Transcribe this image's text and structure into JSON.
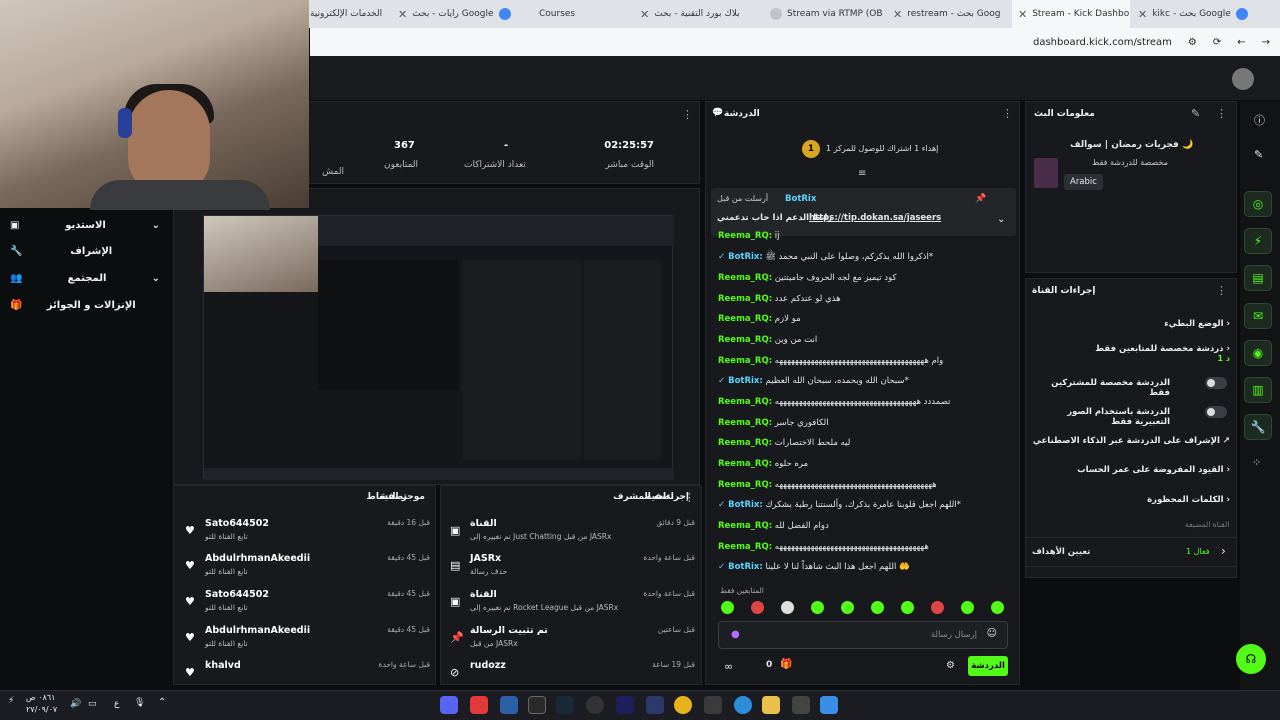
{
  "browser": {
    "tabs": [
      {
        "label": "الخدمات الإلكترونية",
        "color": "#9aa0a6"
      },
      {
        "label": "رايات - بحث Google",
        "color": "#4285f4"
      },
      {
        "label": "Courses",
        "color": "#4285f4"
      },
      {
        "label": "بلاك بورد التقنية - بحث",
        "color": "#ea8600"
      },
      {
        "label": "Stream via RTMP (OB",
        "color": "#1a73e8"
      },
      {
        "label": "restream - بحث Goog",
        "color": "#4285f4"
      },
      {
        "label": "Stream - Kick Dashbo",
        "color": "#53fc18"
      },
      {
        "label": "kikc - بحث Google",
        "color": "#4285f4"
      }
    ],
    "url": "dashboard.kick.com/stream"
  },
  "stats": [
    {
      "value": "02:25:57",
      "label": "الوقت مباشر"
    },
    {
      "value": "-",
      "label": "تعداد الاشتراكات"
    },
    {
      "value": "367",
      "label": "المتابعون"
    }
  ],
  "stats_partial_label": "المش",
  "side_menu": [
    {
      "label": "الاستديو",
      "icon": "studio-icon"
    },
    {
      "label": "الإشراف",
      "icon": "wrench-icon"
    },
    {
      "label": "المجتمع",
      "icon": "community-icon"
    },
    {
      "label": "الإنزالات و الجوائز",
      "icon": "gift-icon"
    }
  ],
  "chat": {
    "title": "الدردشة",
    "goal_text": "إهداء 1 اشتراك للوصول للمركز 1",
    "goal_rank": "1",
    "pinned_by": "أرسلت من قبل",
    "pinned_user": "BotRix",
    "pinned_text": "رابط الدعم اذا حاب تدعمني",
    "pinned_link": "https://tip.dokan.sa/jaseers",
    "messages": [
      {
        "user": "Reema_RQ:",
        "text": "ij",
        "bot": false
      },
      {
        "user": "BotRix:",
        "text": "اذكروا الله يذكركم، وصلوا على النبي محمد ﷺ*",
        "bot": true
      },
      {
        "user": "Reema_RQ:",
        "text": "كود تيميز مع لجه الحروف جاميتتين",
        "bot": false
      },
      {
        "user": "Reema_RQ:",
        "text": "هذي لو عندكم عدد",
        "bot": false
      },
      {
        "user": "Reema_RQ:",
        "text": "مو لازم",
        "bot": false
      },
      {
        "user": "Reema_RQ:",
        "text": "انت من وين",
        "bot": false
      },
      {
        "user": "Reema_RQ:",
        "text": "وام ههههههههههههههههههههههههههههههههههههههه",
        "bot": false
      },
      {
        "user": "BotRix:",
        "text": "سبحان الله وبحمده، سبحان الله العظيم*",
        "bot": true
      },
      {
        "user": "Reema_RQ:",
        "text": "تصمددد ههههههههههههههههههههههههههههههههههههه",
        "bot": false
      },
      {
        "user": "Reema_RQ:",
        "text": "الكافوري جاسر",
        "bot": false
      },
      {
        "user": "Reema_RQ:",
        "text": "ليه ملحط الاختصارات",
        "bot": false
      },
      {
        "user": "Reema_RQ:",
        "text": "مره حلوه",
        "bot": false
      },
      {
        "user": "Reema_RQ:",
        "text": "ههههههههههههههههههههههههههههههههههههههههه",
        "bot": false
      },
      {
        "user": "BotRix:",
        "text": "اللهم اجعل قلوبنا عامرة بذكرك، وألسنتنا رطبة بشكرك*",
        "bot": true
      },
      {
        "user": "Reema_RQ:",
        "text": "دوام الفضل لله",
        "bot": false
      },
      {
        "user": "Reema_RQ:",
        "text": "ههههههههههههههههههههههههههههههههههههههه",
        "bot": false
      },
      {
        "user": "BotRix:",
        "text": "اللهم اجعل هذا البث شاهداً لنا لا علينا 🤲",
        "bot": true
      }
    ],
    "followers_only": "المتابعين فقط",
    "input_placeholder": "إرسال رسالة",
    "send_label": "الدردشة",
    "viewer_count": "0"
  },
  "stream_info": {
    "title": "معلومات البث",
    "stream_title": "فجريات رمضان | سوالف 🌙",
    "chat_mode": "مخصصة للدردشة فقط",
    "language": "Arabic"
  },
  "channel_actions": {
    "title": "إجراءات القناة",
    "items": [
      {
        "label": "الوضع البطيء",
        "type": "chevron"
      },
      {
        "label": "دردشة مخصصة للمتابعين فقط",
        "sub": "1 د",
        "type": "chevron"
      },
      {
        "label": "الدردشة مخصصة للمشتركين فقط",
        "type": "toggle"
      },
      {
        "label": "الدردشة باستخدام الصور التعبيرية فقط",
        "type": "toggle"
      },
      {
        "label": "الإشراف على الدردشة عبر الذكاء الاصطناعي",
        "type": "link"
      },
      {
        "label": "القيود المفروضة على عمر الحساب",
        "type": "chevron"
      },
      {
        "label": "الكلمات المحظورة",
        "type": "chevron"
      }
    ],
    "section_label": "القناة المضيفة",
    "goals_label": "تعيين الأهداف",
    "goals_count": "فعال 1"
  },
  "activity": {
    "title": "موجز النشاط",
    "filter": "تصفية",
    "rows": [
      {
        "name": "Sato644502",
        "sub": "تابع القناة للتو",
        "time": "قبل 16 دقيقة"
      },
      {
        "name": "AbdulrhmanAkeedii",
        "sub": "تابع القناة للتو",
        "time": "قبل 45 دقيقة"
      },
      {
        "name": "Sato644502",
        "sub": "تابع القناة للتو",
        "time": "قبل 45 دقيقة"
      },
      {
        "name": "AbdulrhmanAkeedii",
        "sub": "تابع القناة للتو",
        "time": "قبل 45 دقيقة"
      },
      {
        "name": "khalvd",
        "sub": "",
        "time": "قبل ساعة واحدة"
      }
    ]
  },
  "mod_actions": {
    "title": "إجراءات المشرف",
    "filter": "تصفية",
    "rows": [
      {
        "name": "القناة",
        "sub": "تم تغييره إلى Just Chatting من قبل JASRx",
        "time": "قبل 9 دقائق"
      },
      {
        "name": "JASRx",
        "sub": "حذف رسالة",
        "time": "قبل ساعة واحدة"
      },
      {
        "name": "القناة",
        "sub": "تم تغييره إلى Rocket League من قبل JASRx",
        "time": "قبل ساعة واحدة"
      },
      {
        "name": "تم تثبيت الرسالة",
        "sub": "من قبل JASRx",
        "time": "قبل ساعتين"
      },
      {
        "name": "rudozz",
        "sub": "",
        "time": "قبل 19 ساعة"
      }
    ]
  },
  "taskbar": {
    "time": "٠٨٦١ ص",
    "date": "٢٧/٠٩/٠٧",
    "lang": "ع"
  }
}
